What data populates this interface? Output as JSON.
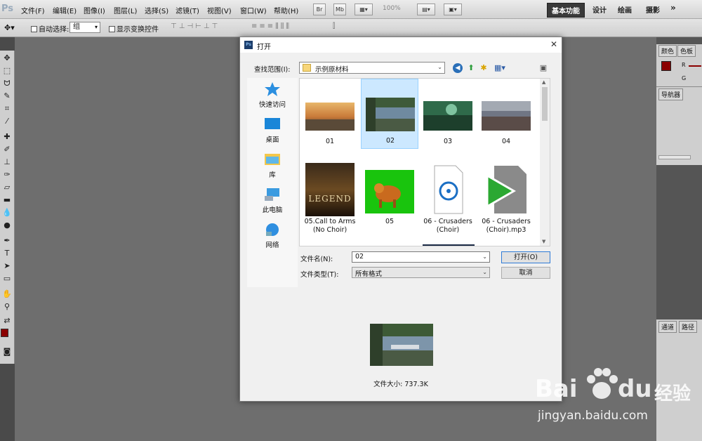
{
  "menubar": {
    "logo": "Ps",
    "items": [
      "文件(F)",
      "编辑(E)",
      "图像(I)",
      "图层(L)",
      "选择(S)",
      "滤镜(T)",
      "视图(V)",
      "窗口(W)",
      "帮助(H)"
    ],
    "buttons": [
      "Br",
      "Mb"
    ],
    "zoom": "100%",
    "workspaces": [
      "基本功能",
      "设计",
      "绘画",
      "摄影"
    ],
    "more": "»"
  },
  "options": {
    "auto_select_label": "自动选择:",
    "auto_select_value": "组",
    "show_transform_label": "显示变换控件"
  },
  "right_panel": {
    "tabs_top": [
      "颜色",
      "色板"
    ],
    "r_label": "R",
    "g_label": "G",
    "navigator_tab": "导航器",
    "tabs_bottom": [
      "通道",
      "路径"
    ]
  },
  "dialog": {
    "title": "打开",
    "look_in_label": "查找范围(I):",
    "look_in_value": "示例原材料",
    "places": [
      "快速访问",
      "桌面",
      "库",
      "此电脑",
      "网络"
    ],
    "files": [
      {
        "name": "01",
        "kind": "image",
        "selected": false
      },
      {
        "name": "02",
        "kind": "image",
        "selected": true
      },
      {
        "name": "03",
        "kind": "image",
        "selected": false
      },
      {
        "name": "04",
        "kind": "image",
        "selected": false
      },
      {
        "name": "05.Call to Arms\n(No Choir)",
        "kind": "legend",
        "thumb_text": "LEGEND",
        "selected": false
      },
      {
        "name": "05",
        "kind": "tiger",
        "selected": false
      },
      {
        "name": "06 - Crusaders\n(Choir)",
        "kind": "audio",
        "selected": false
      },
      {
        "name": "06 - Crusaders\n(Choir).mp3",
        "kind": "media",
        "selected": false
      }
    ],
    "file_name_label": "文件名(N):",
    "file_name_value": "02",
    "file_type_label": "文件类型(T):",
    "file_type_value": "所有格式",
    "open_button": "打开(O)",
    "cancel_button": "取消",
    "file_size": "文件大小: 737.3K"
  },
  "watermark": {
    "brand": "Bai",
    "brand2": "du",
    "product": "经验",
    "url": "jingyan.baidu.com"
  },
  "colors": {
    "foreground": "#8b0000",
    "accent_selection": "#cce8ff",
    "dialog_bg": "#f0f0f0",
    "workspace_bg": "#6e6e6e"
  }
}
